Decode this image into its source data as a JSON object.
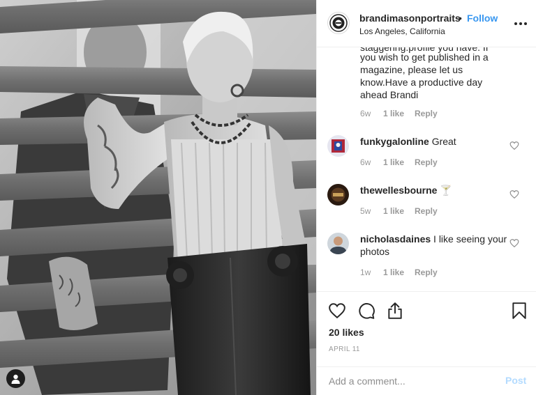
{
  "post": {
    "photo_alt": "",
    "tagged_user_icon": "person-icon"
  },
  "header": {
    "username": "brandimasonportraits",
    "separator": "•",
    "follow_label": "Follow",
    "location": "Los Angeles, California",
    "more_icon": "ellipsis-icon"
  },
  "caption": {
    "cut_line": "staggering.profile you have. If",
    "text": "you wish to get published in a magazine, please let us know.Have a productive day ahead Brandi",
    "time": "6w",
    "likes": "1 like",
    "reply": "Reply"
  },
  "comments": [
    {
      "username": "funkygalonline",
      "text": "Great",
      "time": "6w",
      "likes": "1 like",
      "reply": "Reply"
    },
    {
      "username": "thewellesbourne",
      "text": "🍸",
      "time": "5w",
      "likes": "1 like",
      "reply": "Reply"
    },
    {
      "username": "nicholasdaines",
      "text": "I like seeing your photos",
      "time": "1w",
      "likes": "1 like",
      "reply": "Reply"
    }
  ],
  "actions": {
    "like_icon": "heart-icon",
    "comment_icon": "comment-bubble-icon",
    "share_icon": "share-icon",
    "save_icon": "bookmark-icon",
    "likes_count": "20 likes",
    "date": "APRIL 11"
  },
  "add_comment": {
    "placeholder": "Add a comment...",
    "post_label": "Post"
  },
  "colors": {
    "accent_blue": "#3897f0",
    "post_disabled": "#b3dbff",
    "meta_gray": "#999999",
    "text": "#262626",
    "divider": "#efefef"
  }
}
